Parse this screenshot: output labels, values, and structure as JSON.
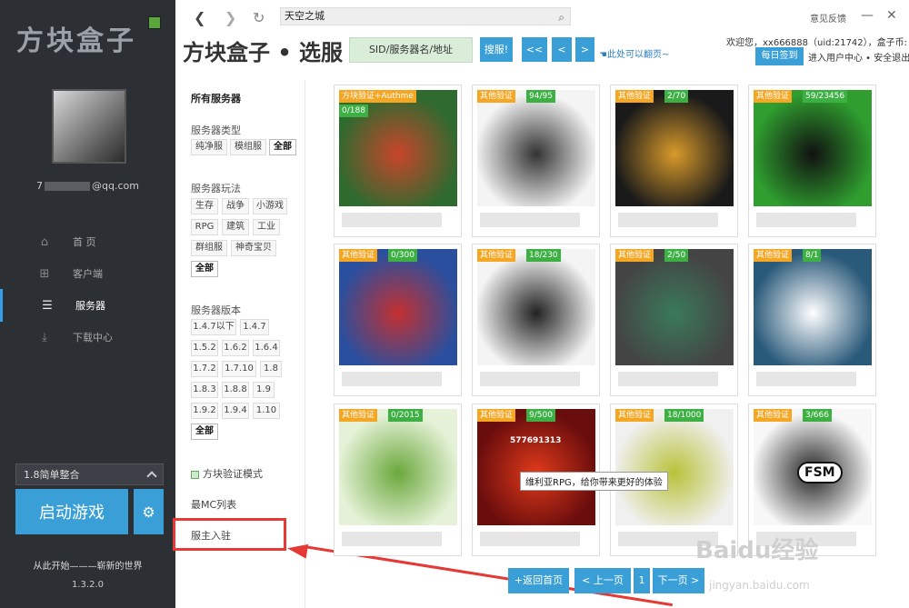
{
  "sidebar": {
    "logo": "方块盒子",
    "email": "7 @qq.com",
    "email_prefix": "7",
    "email_suffix": "@qq.com",
    "nav": [
      {
        "label": "首  页",
        "icon": "home-icon"
      },
      {
        "label": "客户端",
        "icon": "grid-icon"
      },
      {
        "label": "服务器",
        "icon": "server-icon",
        "active": true
      },
      {
        "label": "下载中心",
        "icon": "download-icon"
      }
    ],
    "version_select": "1.8简单整合",
    "start_button": "启动游戏",
    "slogan": "从此开始———崭新的世界",
    "app_version": "1.3.2.0"
  },
  "toolbar": {
    "address": "天空之城",
    "feedback": "意见反馈"
  },
  "header": {
    "title": "方块盒子 • 选服",
    "sid_input": "SID/服务器名/地址",
    "search_button": "搜服!",
    "first_button": "<<",
    "prev_button": "<",
    "next_button": ">",
    "flip_hint": "此处可以翻页~",
    "welcome": "欢迎您，xx666888（uid:21742），盒子币:",
    "checkin_button": "每日签到",
    "user_center": "进入用户中心 • 安全退出"
  },
  "filters": {
    "all_servers": "所有服务器",
    "type_label": "服务器类型",
    "types": [
      "纯净服",
      "模组服",
      "全部"
    ],
    "play_label": "服务器玩法",
    "plays": [
      "生存",
      "战争",
      "小游戏",
      "RPG",
      "建筑",
      "工业",
      "群组服",
      "神奇宝贝",
      "全部"
    ],
    "version_label": "服务器版本",
    "versions": [
      "1.4.7以下",
      "1.4.7",
      "1.5.2",
      "1.6.2",
      "1.6.4",
      "1.7.2",
      "1.7.10",
      "1.8",
      "1.8.3",
      "1.8.8",
      "1.9",
      "1.9.2",
      "1.9.4",
      "1.10",
      "全部"
    ],
    "verify_mode": "方块验证模式",
    "mc_list": "最MC列表",
    "owner_join": "服主入驻"
  },
  "cards": [
    {
      "tag": "方块验证+Authme",
      "count": "0/188",
      "colors": [
        "#2f6a2f",
        "#c9452a"
      ]
    },
    {
      "tag": "其他验证",
      "count": "94/95",
      "colors": [
        "#f4f4f4",
        "#333333"
      ]
    },
    {
      "tag": "其他验证",
      "count": "2/70",
      "colors": [
        "#1a1a1a",
        "#d89a2a"
      ]
    },
    {
      "tag": "其他验证",
      "count": "59/23456",
      "colors": [
        "#2f9e2f",
        "#111111"
      ]
    },
    {
      "tag": "其他验证",
      "count": "0/300",
      "colors": [
        "#2a4f9e",
        "#c43030"
      ]
    },
    {
      "tag": "其他验证",
      "count": "18/230",
      "colors": [
        "#f4f4f4",
        "#222222"
      ]
    },
    {
      "tag": "其他验证",
      "count": "2/50",
      "colors": [
        "#444444",
        "#3a7a5a"
      ]
    },
    {
      "tag": "其他验证",
      "count": "8/1",
      "colors": [
        "#2a5a7a",
        "#ffffff"
      ]
    },
    {
      "tag": "其他验证",
      "count": "0/2015",
      "colors": [
        "#e6f2d8",
        "#6aa83c"
      ]
    },
    {
      "tag": "其他验证",
      "count": "9/500",
      "colors": [
        "#6a0d0d",
        "#e03a1a"
      ],
      "extra_text": "577691313"
    },
    {
      "tag": "其他验证",
      "count": "18/1000",
      "colors": [
        "#f0f0f0",
        "#b9c23a"
      ]
    },
    {
      "tag": "其他验证",
      "count": "3/666",
      "colors": [
        "#f7f7f7",
        "#222222"
      ],
      "extra_text": "FSM"
    }
  ],
  "tooltip": "维利亚RPG，给你带来更好的体验",
  "pagination": {
    "home": "+返回首页",
    "prev": "< 上一页",
    "page": "1",
    "next": "下一页 >"
  },
  "watermark": {
    "brand": "Baidu经验",
    "url": "jingyan.baidu.com"
  },
  "colors": {
    "sidebar_bg": "#2c2f33",
    "accent": "#3a9fd6",
    "tag_orange": "#f5a623",
    "count_green": "#3cb043",
    "highlight_red": "#e53935"
  }
}
